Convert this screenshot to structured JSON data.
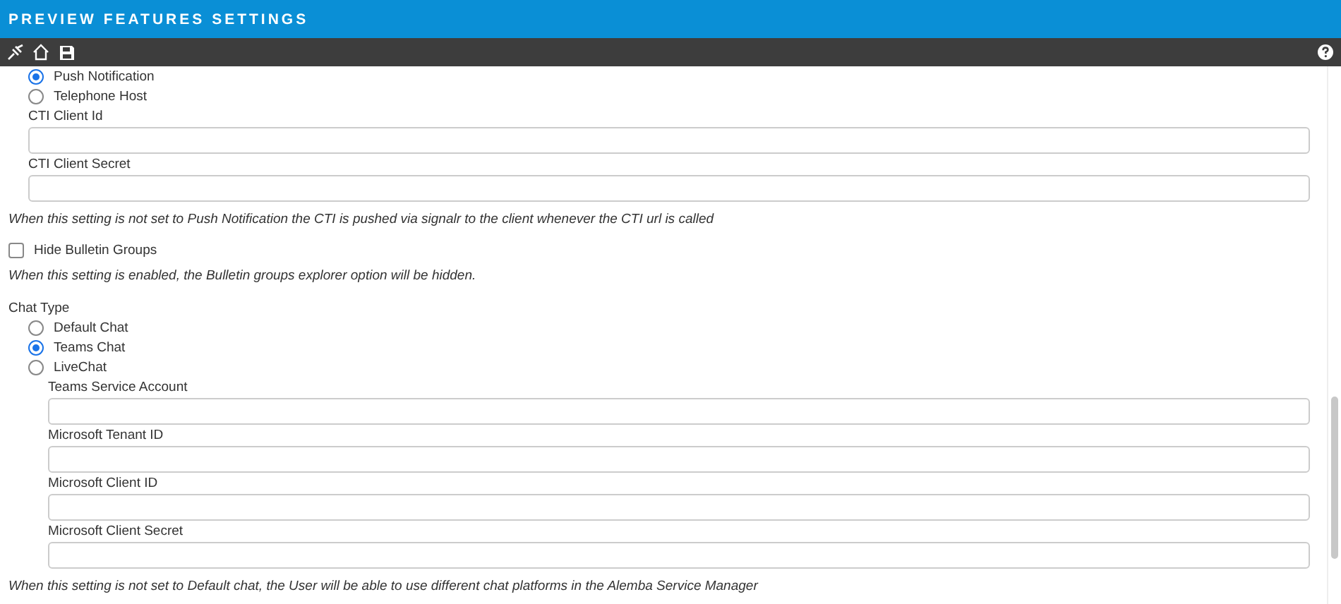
{
  "header": {
    "title": "PREVIEW FEATURES SETTINGS"
  },
  "cti": {
    "radios": [
      {
        "label": "Push Notification",
        "selected": true
      },
      {
        "label": "Telephone Host",
        "selected": false
      }
    ],
    "fields": [
      {
        "label": "CTI Client Id"
      },
      {
        "label": "CTI Client Secret"
      }
    ],
    "note": "When this setting is not set to Push Notification the CTI is pushed via signalr to the client whenever the CTI url is called"
  },
  "bulletin": {
    "label": "Hide Bulletin Groups",
    "checked": false,
    "note": "When this setting is enabled, the Bulletin groups explorer option will be hidden."
  },
  "chat": {
    "label": "Chat Type",
    "radios": [
      {
        "label": "Default Chat",
        "selected": false
      },
      {
        "label": "Teams Chat",
        "selected": true
      },
      {
        "label": "LiveChat",
        "selected": false
      }
    ],
    "fields": [
      {
        "label": "Teams Service Account"
      },
      {
        "label": "Microsoft Tenant ID"
      },
      {
        "label": "Microsoft Client ID"
      },
      {
        "label": "Microsoft Client Secret"
      }
    ],
    "note": "When this setting is not set to Default chat, the User will be able to use different chat platforms in the Alemba Service Manager"
  }
}
